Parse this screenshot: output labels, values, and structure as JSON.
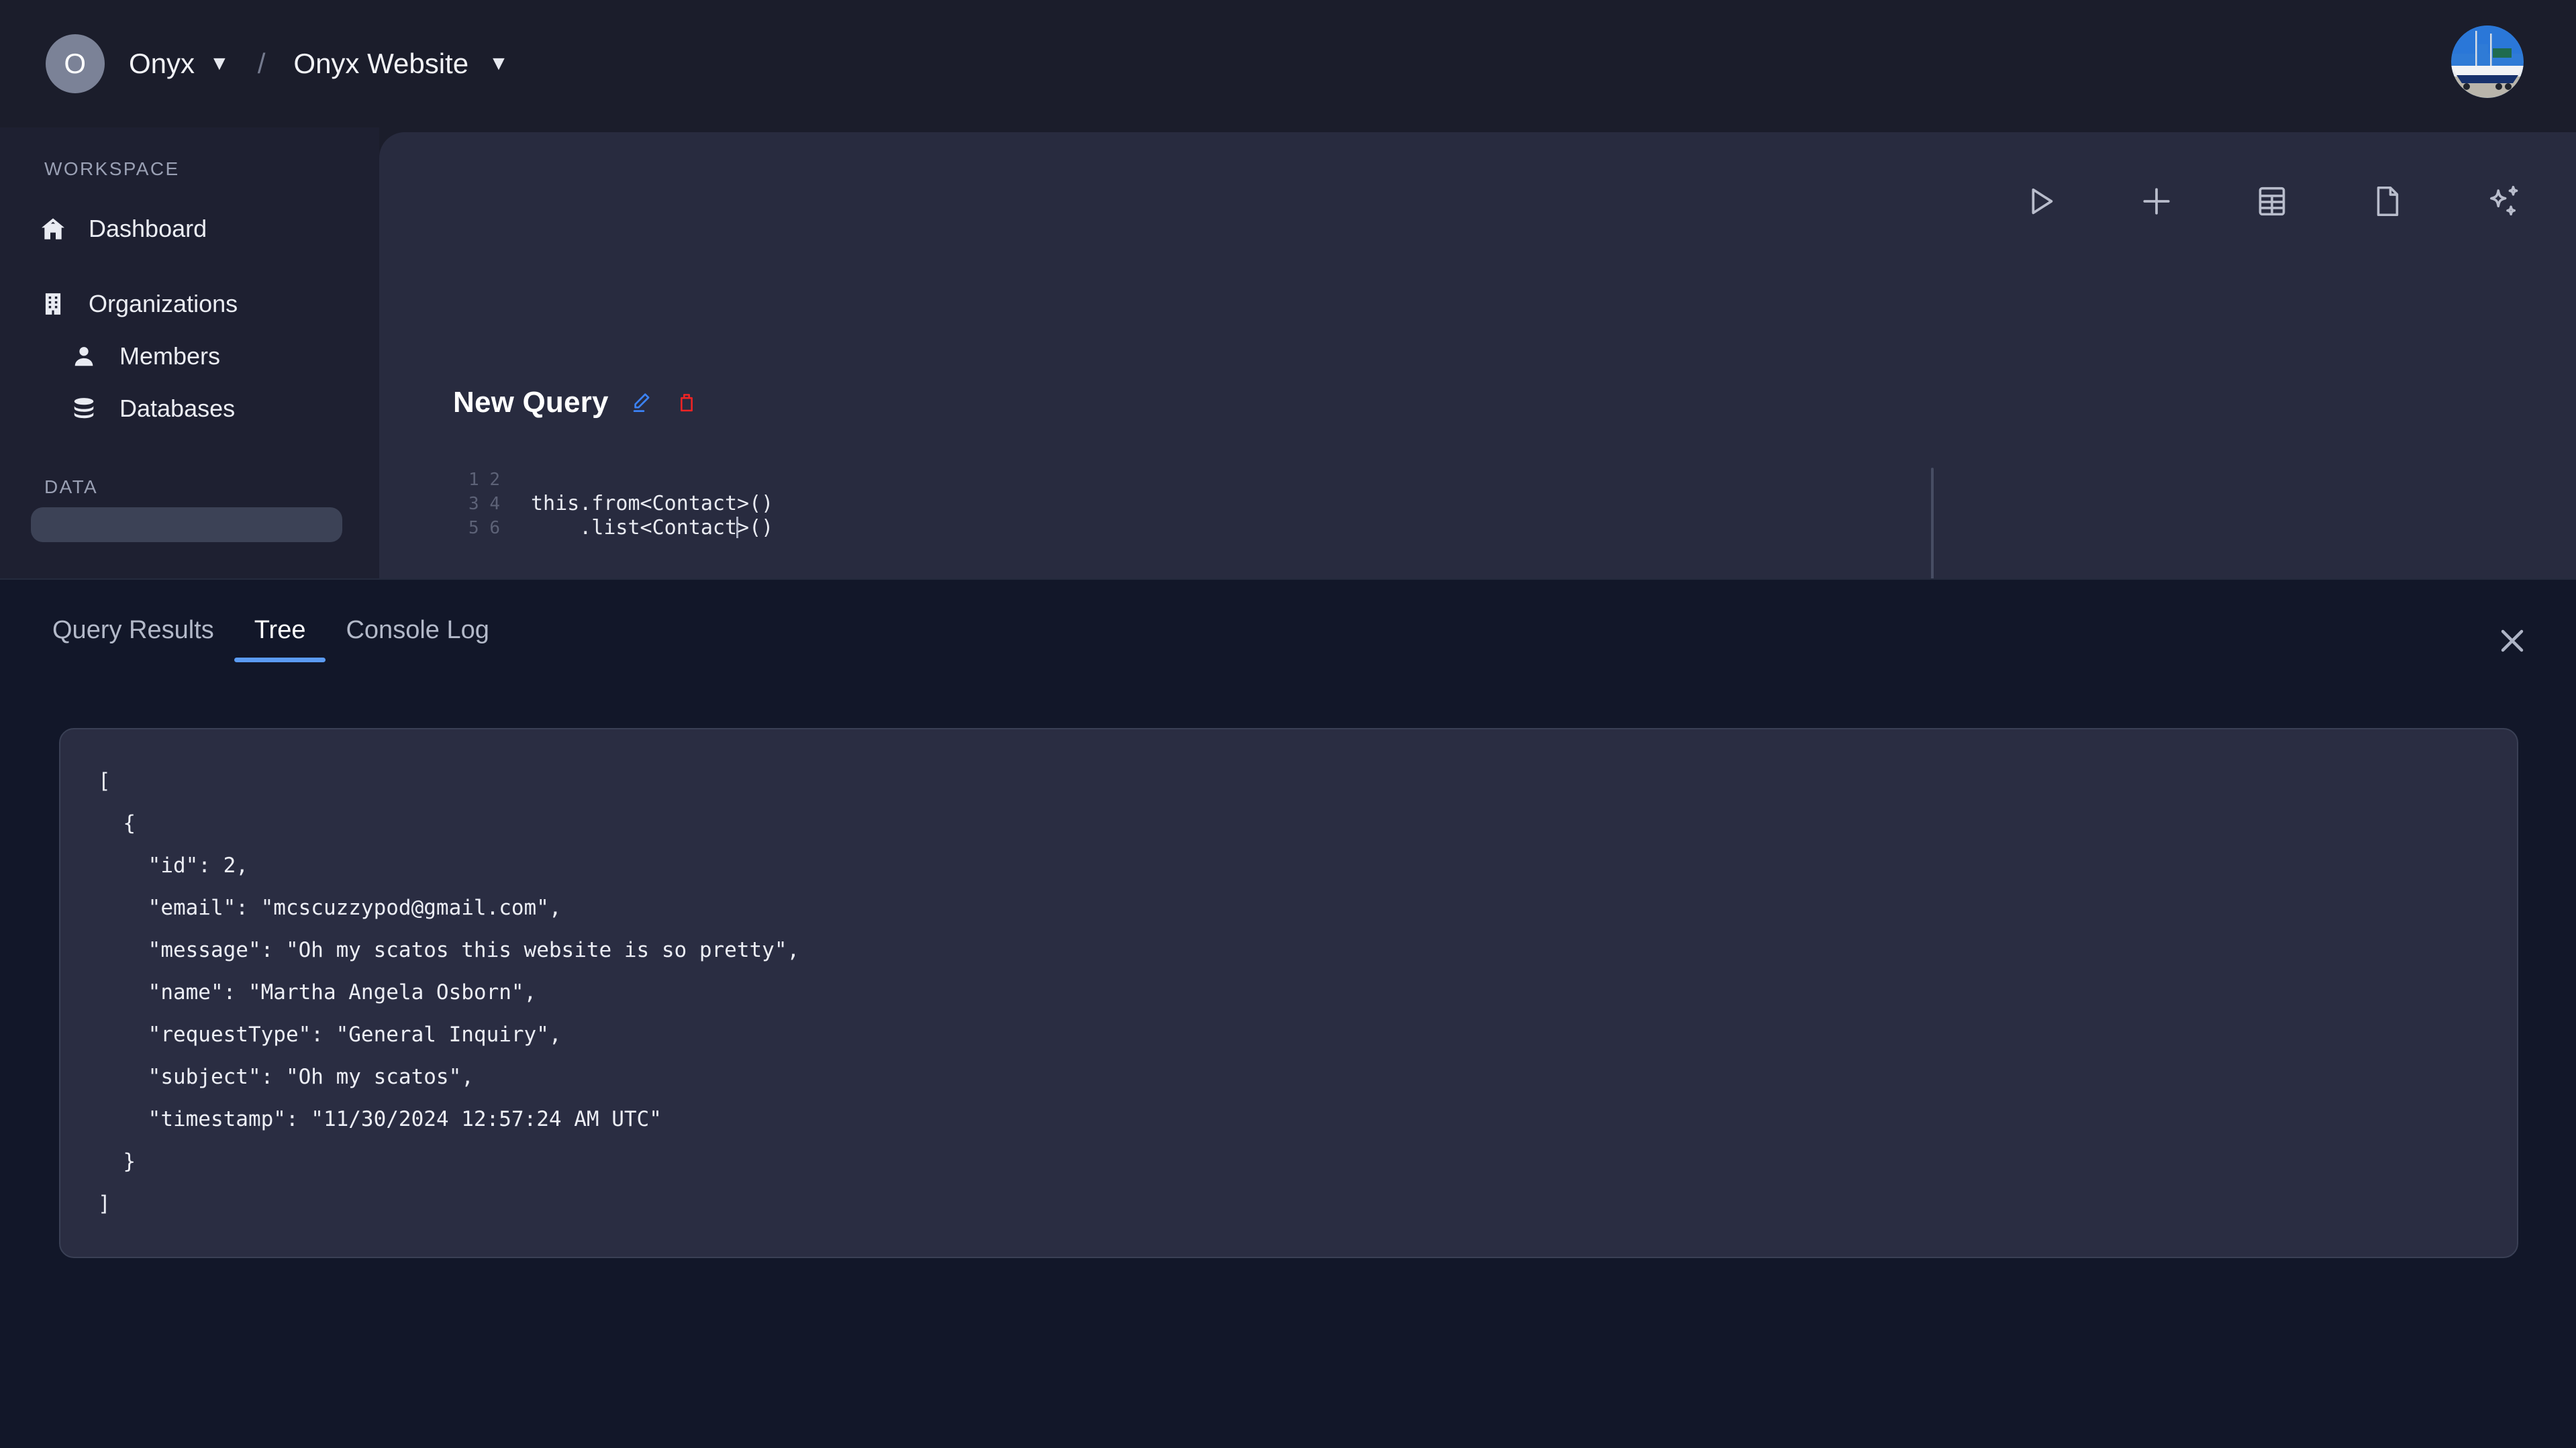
{
  "topbar": {
    "org_initial": "O",
    "org_name": "Onyx",
    "org_caret": "▼",
    "separator": "/",
    "project_name": "Onyx Website",
    "project_caret": "▼",
    "avatar_alt": "sailboat-photo"
  },
  "sidebar": {
    "sections": [
      {
        "label": "WORKSPACE",
        "items": [
          {
            "label": "Dashboard",
            "icon": "home-icon",
            "indent": false
          },
          {
            "label": "Organizations",
            "icon": "building-icon",
            "indent": false
          },
          {
            "label": "Members",
            "icon": "user-icon",
            "indent": true
          },
          {
            "label": "Databases",
            "icon": "database-icon",
            "indent": true
          }
        ]
      },
      {
        "label": "DATA",
        "items": []
      }
    ]
  },
  "editor": {
    "toolbar": [
      {
        "name": "run-query-button",
        "icon": "play-icon"
      },
      {
        "name": "add-query-button",
        "icon": "plus-icon"
      },
      {
        "name": "table-view-button",
        "icon": "table-icon"
      },
      {
        "name": "document-button",
        "icon": "file-icon"
      },
      {
        "name": "ai-assist-button",
        "icon": "sparkles-icon"
      }
    ],
    "query_title": "New Query",
    "edit_icon": "pencil-icon",
    "delete_icon": "trash-icon",
    "gutter": "1\n2\n3\n4\n5\n6",
    "code_line_1": "",
    "code_line_2": "this.from<Contact>()",
    "code_line_3_pre": "    .list<Contact",
    "code_line_3_post": ">()",
    "accent_edit": "#3b82f6",
    "accent_delete": "#ef2424"
  },
  "results": {
    "tabs": [
      {
        "label": "Query Results",
        "active": false
      },
      {
        "label": "Tree",
        "active": true
      },
      {
        "label": "Console Log",
        "active": false
      }
    ],
    "close_icon": "close-icon",
    "active_tab_color": "#5b9bf3",
    "json_text": "[\n  {\n    \"id\": 2,\n    \"email\": \"mcscuzzypod@gmail.com\",\n    \"message\": \"Oh my scatos this website is so pretty\",\n    \"name\": \"Martha Angela Osborn\",\n    \"requestType\": \"General Inquiry\",\n    \"subject\": \"Oh my scatos\",\n    \"timestamp\": \"11/30/2024 12:57:24 AM UTC\"\n  }\n]",
    "record": {
      "id": 2,
      "email": "mcscuzzypod@gmail.com",
      "message": "Oh my scatos this website is so pretty",
      "name": "Martha Angela Osborn",
      "requestType": "General Inquiry",
      "subject": "Oh my scatos",
      "timestamp": "11/30/2024 12:57:24 AM UTC"
    }
  }
}
